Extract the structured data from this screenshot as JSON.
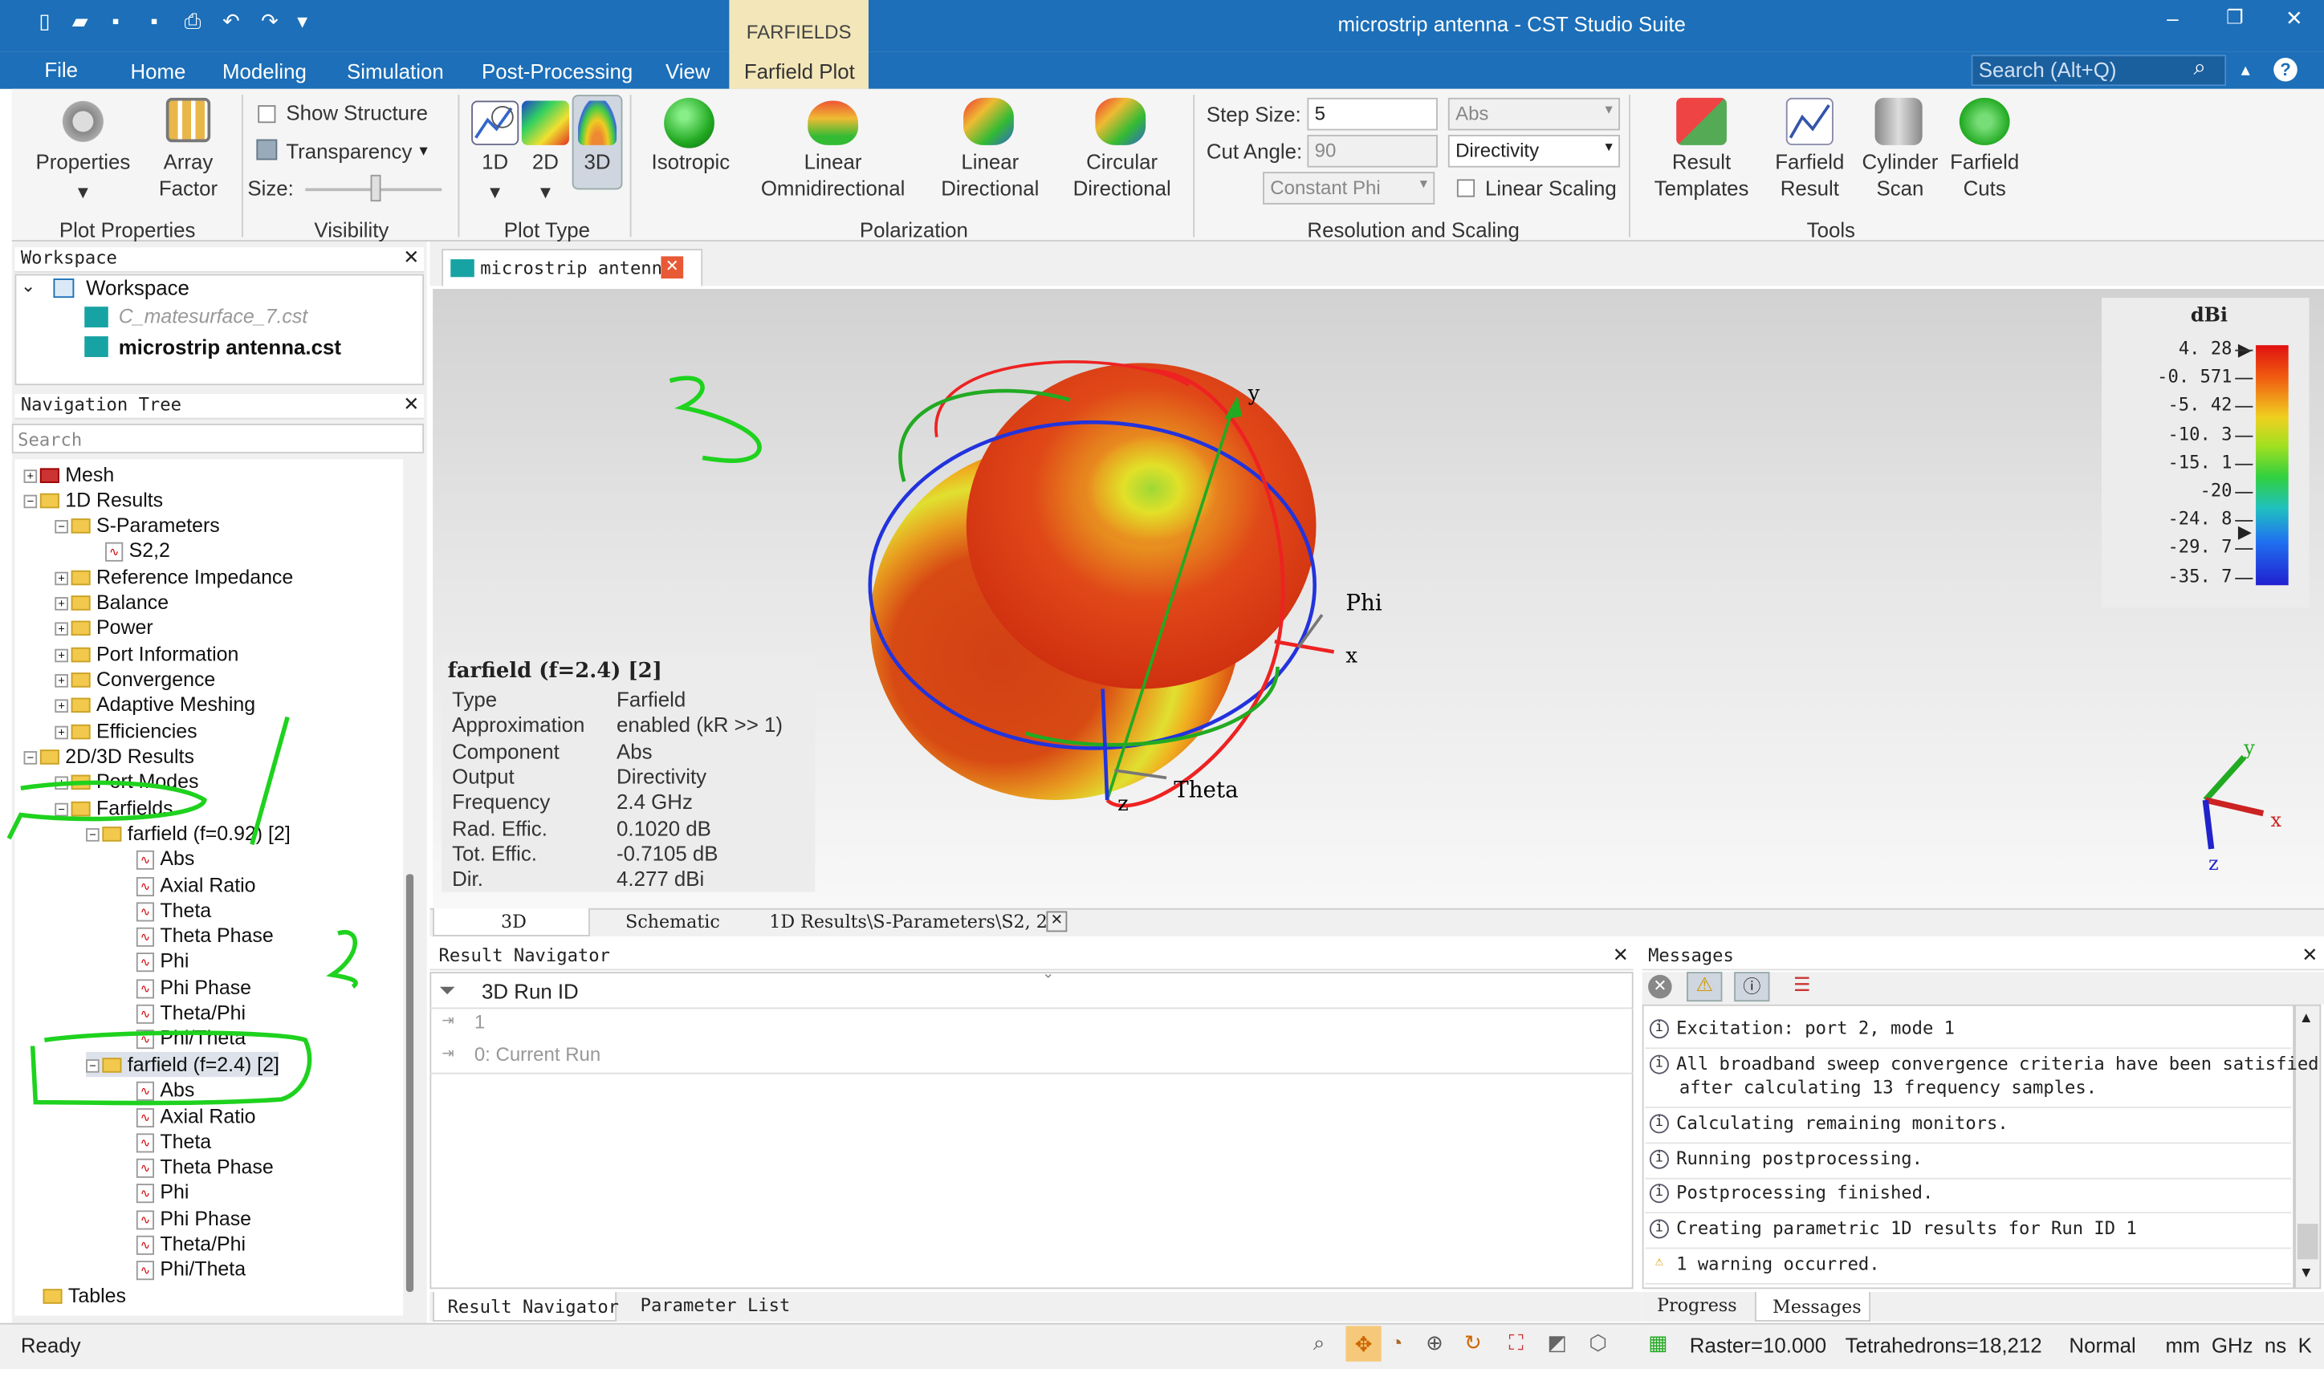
{
  "window": {
    "title": "microstrip antenna - CST Studio Suite",
    "contextual_tab": "FARFIELDS",
    "search_placeholder": "Search (Alt+Q)"
  },
  "menu": [
    "File",
    "Home",
    "Modeling",
    "Simulation",
    "Post-Processing",
    "View",
    "Farfield Plot"
  ],
  "ribbon": {
    "plot_properties": {
      "properties": "Properties",
      "array_factor_1": "Array",
      "array_factor_2": "Factor",
      "group": "Plot Properties"
    },
    "visibility": {
      "show_structure": "Show Structure",
      "transparency": "Transparency",
      "size": "Size:",
      "group": "Visibility"
    },
    "plot_type": {
      "b1": "1D",
      "b2": "2D",
      "b3": "3D",
      "group": "Plot Type"
    },
    "polarization": {
      "isotropic": "Isotropic",
      "lin_omni_1": "Linear",
      "lin_omni_2": "Omnidirectional",
      "lin_dir_1": "Linear",
      "lin_dir_2": "Directional",
      "circ_dir_1": "Circular",
      "circ_dir_2": "Directional",
      "group": "Polarization"
    },
    "resolution": {
      "step_label": "Step Size:",
      "step_value": "5",
      "cut_label": "Cut Angle:",
      "cut_value": "90",
      "component": "Abs",
      "output": "Directivity",
      "constant": "Constant Phi",
      "linear_scaling": "Linear Scaling",
      "group": "Resolution and Scaling"
    },
    "tools": {
      "rt1": "Result",
      "rt2": "Templates",
      "fr1": "Farfield",
      "fr2": "Result",
      "cs1": "Cylinder",
      "cs2": "Scan",
      "fc1": "Farfield",
      "fc2": "Cuts",
      "group": "Tools"
    }
  },
  "workspace": {
    "title": "Workspace",
    "root": "Workspace",
    "files": [
      "C_matesurface_7.cst",
      "microstrip antenna.cst"
    ]
  },
  "nav": {
    "title": "Navigation Tree",
    "search_placeholder": "Search",
    "items": [
      "Mesh",
      "1D Results",
      "S-Parameters",
      "S2,2",
      "Reference Impedance",
      "Balance",
      "Power",
      "Port Information",
      "Convergence",
      "Adaptive Meshing",
      "Efficiencies",
      "2D/3D Results",
      "Port Modes",
      "Farfields",
      "farfield (f=0.92) [2]",
      "Abs",
      "Axial Ratio",
      "Theta",
      "Theta Phase",
      "Phi",
      "Phi Phase",
      "Theta/Phi",
      "Phi/Theta",
      "farfield (f=2.4) [2]",
      "Abs",
      "Axial Ratio",
      "Theta",
      "Theta Phase",
      "Phi",
      "Phi Phase",
      "Theta/Phi",
      "Phi/Theta",
      "Tables"
    ]
  },
  "doc_tab": "microstrip antenna",
  "plot": {
    "info_title": "farfield (f=2.4) [2]",
    "info": [
      [
        "Type",
        "Farfield"
      ],
      [
        "Approximation",
        "enabled (kR >> 1)"
      ],
      [
        "Component",
        "Abs"
      ],
      [
        "Output",
        "Directivity"
      ],
      [
        "Frequency",
        "2.4 GHz"
      ],
      [
        "Rad. Effic.",
        "0.1020 dB"
      ],
      [
        "Tot. Effic.",
        "-0.7105 dB"
      ],
      [
        "Dir.",
        "4.277 dBi"
      ]
    ],
    "axes": {
      "y": "y",
      "x": "x",
      "z": "z",
      "phi": "Phi",
      "theta": "Theta"
    },
    "legend_unit": "dBi",
    "legend_ticks": [
      "4. 28",
      "-0. 571",
      "-5. 42",
      "-10. 3",
      "-15. 1",
      "-20",
      "-24. 8",
      "-29. 7",
      "-35. 7"
    ],
    "annotations": [
      "3",
      "2"
    ]
  },
  "view_tabs": [
    "3D",
    "Schematic",
    "1D Results\\S-Parameters\\S2, 2"
  ],
  "result_nav": {
    "title": "Result Navigator",
    "column": "3D Run ID",
    "rows": [
      "1",
      "0: Current Run"
    ],
    "tabs": [
      "Result Navigator",
      "Parameter List"
    ]
  },
  "messages": {
    "title": "Messages",
    "lines": [
      "Excitation: port 2, mode 1",
      "All broadband sweep convergence criteria have been satisfied",
      "after calculating 13 frequency samples.",
      "Calculating remaining monitors.",
      "Running postprocessing.",
      "Postprocessing finished.",
      "Creating parametric 1D results for Run ID 1",
      "1 warning occurred."
    ],
    "tabs": [
      "Progress",
      "Messages"
    ]
  },
  "status": {
    "ready": "Ready",
    "raster": "Raster=10.000",
    "tetra": "Tetrahedrons=18,212",
    "mode": "Normal",
    "units": "mm  GHz  ns  K"
  },
  "colors": {
    "title_blue": "#1c6fb8",
    "context_tab": "#f3e7b9",
    "annotation_green": "#1ed21e"
  }
}
